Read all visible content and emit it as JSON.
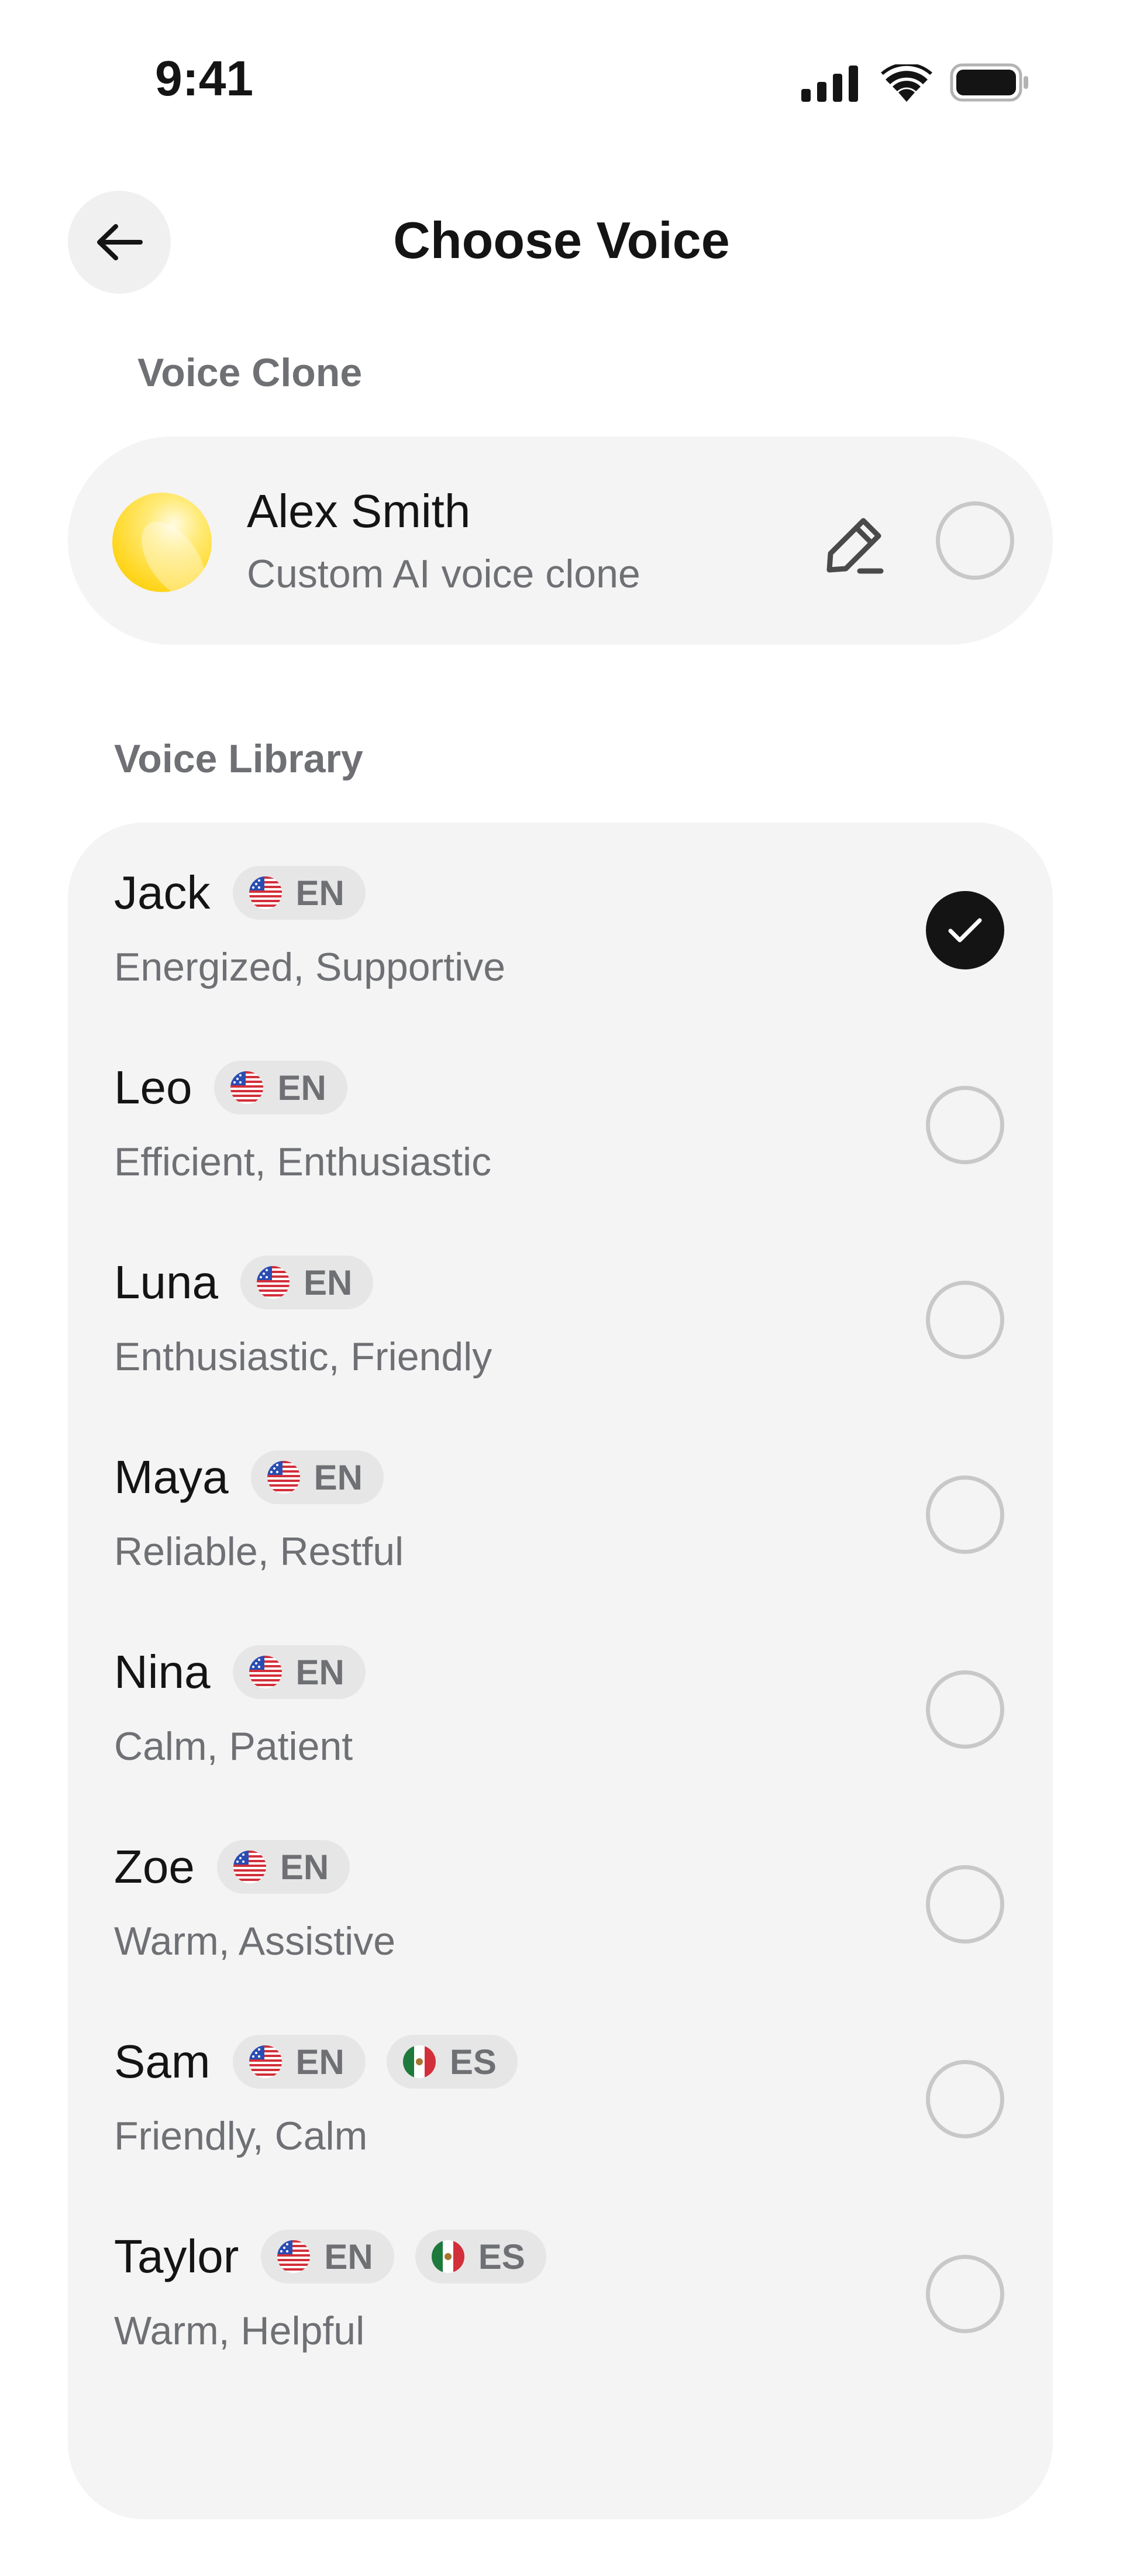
{
  "status_bar": {
    "time": "9:41"
  },
  "header": {
    "title": "Choose Voice"
  },
  "voice_clone": {
    "section_label": "Voice Clone",
    "name": "Alex Smith",
    "description": "Custom AI voice clone",
    "selected": false
  },
  "voice_library": {
    "section_label": "Voice Library",
    "voices": [
      {
        "name": "Jack",
        "languages": [
          {
            "flag": "us-flag-icon",
            "code": "EN"
          }
        ],
        "description": "Energized, Supportive",
        "selected": true
      },
      {
        "name": "Leo",
        "languages": [
          {
            "flag": "us-flag-icon",
            "code": "EN"
          }
        ],
        "description": "Efficient, Enthusiastic",
        "selected": false
      },
      {
        "name": "Luna",
        "languages": [
          {
            "flag": "us-flag-icon",
            "code": "EN"
          }
        ],
        "description": "Enthusiastic, Friendly",
        "selected": false
      },
      {
        "name": "Maya",
        "languages": [
          {
            "flag": "us-flag-icon",
            "code": "EN"
          }
        ],
        "description": "Reliable, Restful",
        "selected": false
      },
      {
        "name": "Nina",
        "languages": [
          {
            "flag": "us-flag-icon",
            "code": "EN"
          }
        ],
        "description": "Calm, Patient",
        "selected": false
      },
      {
        "name": "Zoe",
        "languages": [
          {
            "flag": "us-flag-icon",
            "code": "EN"
          }
        ],
        "description": "Warm, Assistive",
        "selected": false
      },
      {
        "name": "Sam",
        "languages": [
          {
            "flag": "us-flag-icon",
            "code": "EN"
          },
          {
            "flag": "mx-flag-icon",
            "code": "ES"
          }
        ],
        "description": "Friendly, Calm",
        "selected": false
      },
      {
        "name": "Taylor",
        "languages": [
          {
            "flag": "us-flag-icon",
            "code": "EN"
          },
          {
            "flag": "mx-flag-icon",
            "code": "ES"
          }
        ],
        "description": "Warm, Helpful",
        "selected": false
      }
    ]
  },
  "colors": {
    "text_primary": "#141414",
    "text_secondary": "#6e7074",
    "card_background": "#f4f4f4",
    "badge_background": "#e6e6e6",
    "selected_radio": "#141414",
    "unselected_radio_border": "#c8c8c8",
    "avatar_yellow": "#ffd61f"
  }
}
